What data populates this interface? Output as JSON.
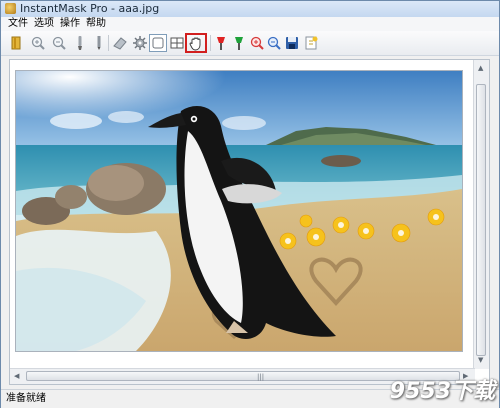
{
  "window": {
    "title": "InstantMask Pro - aaa.jpg"
  },
  "menu": {
    "items": [
      "文件",
      "选项",
      "操作",
      "帮助"
    ]
  },
  "toolbar": {
    "tools": [
      {
        "name": "open-icon"
      },
      {
        "name": "zoom-in-icon"
      },
      {
        "name": "zoom-out-icon"
      },
      {
        "name": "brush-icon"
      },
      {
        "name": "pencil-icon"
      },
      {
        "name": "eraser-icon"
      },
      {
        "name": "settings-icon"
      },
      {
        "name": "fit-view-icon"
      },
      {
        "name": "grid-view-icon"
      },
      {
        "name": "hand-pan-icon"
      },
      {
        "name": "red-marker-icon"
      },
      {
        "name": "green-marker-icon"
      },
      {
        "name": "red-zoom-icon"
      },
      {
        "name": "blue-zoom-icon"
      },
      {
        "name": "save-icon"
      },
      {
        "name": "export-icon"
      }
    ],
    "active_tool": "hand-pan-icon"
  },
  "status": {
    "text": "准备就绪"
  },
  "watermark": {
    "text": "9553下载"
  }
}
